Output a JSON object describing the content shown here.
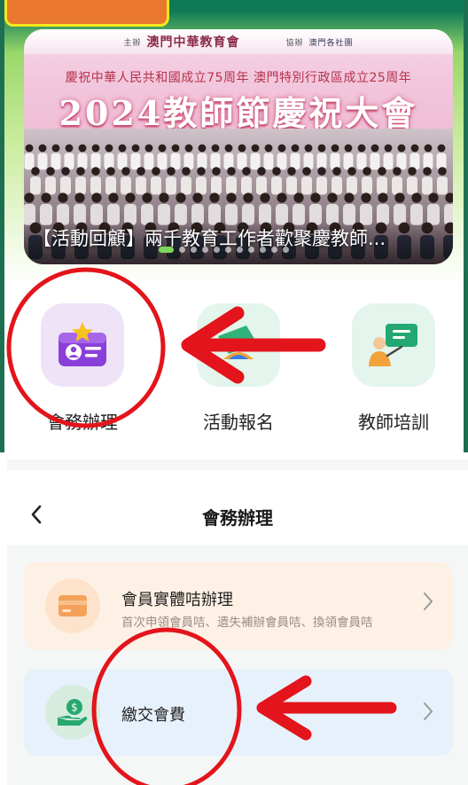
{
  "banner": {
    "ribbon_left": "主辦",
    "ribbon_org": "澳門中華教育會",
    "ribbon_right": "協辦",
    "ribbon_partner": "澳門各社團",
    "subtitle_line": "慶祝中華人民共和國成立75周年 澳門特別行政區成立25周年",
    "main_title": "2024教師節慶祝大會",
    "caption": "【活動回顧】兩千教育工作者歡聚慶教師..."
  },
  "carousel": {
    "total_dots": 11,
    "active_index": 0
  },
  "quick_menu": [
    {
      "label": "會務辦理",
      "icon": "member-card-icon",
      "bg": "#efe3f7"
    },
    {
      "label": "活動報名",
      "icon": "activity-icon",
      "bg": "#e3f5ec"
    },
    {
      "label": "教師培訓",
      "icon": "teacher-training-icon",
      "bg": "#e3f5ec"
    }
  ],
  "sub_page": {
    "back_icon": "chevron-left-icon",
    "title": "會務辦理",
    "items": [
      {
        "title": "會員實體咭辦理",
        "subtitle": "首次申領會員咭、遺失補辦會員咭、換領會員咭",
        "icon": "card-icon"
      },
      {
        "title": "繳交會費",
        "subtitle": "",
        "icon": "money-hand-icon"
      }
    ]
  },
  "colors": {
    "frame_green": "#1d6f52",
    "tab_orange": "#e9772e",
    "tab_border": "#f6e81b",
    "annotation_red": "#e3141b",
    "dot_active": "#7ed75a"
  }
}
